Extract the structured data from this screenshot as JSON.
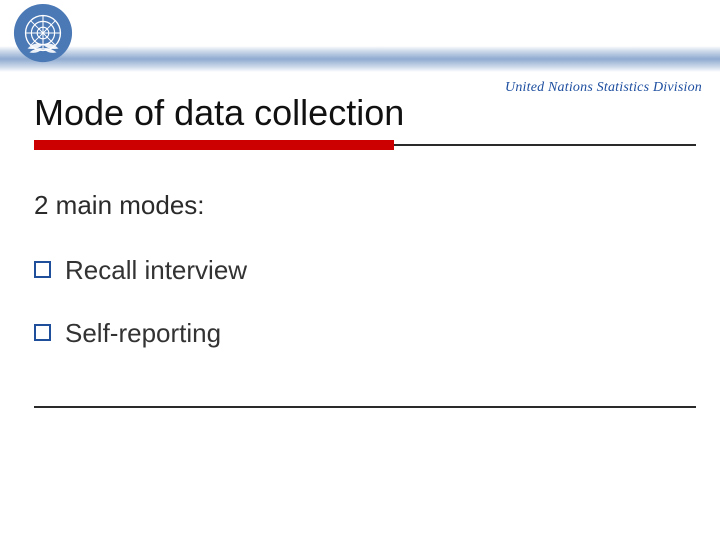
{
  "brand": "United Nations Statistics Division",
  "title": "Mode of data collection",
  "subhead": "2 main modes:",
  "bullets": [
    "Recall interview",
    "Self-reporting"
  ],
  "colors": {
    "accent_red": "#cc0000",
    "accent_blue": "#1d4e9f",
    "bullet_border": "#1f4e9a"
  },
  "logo_name": "un-emblem"
}
